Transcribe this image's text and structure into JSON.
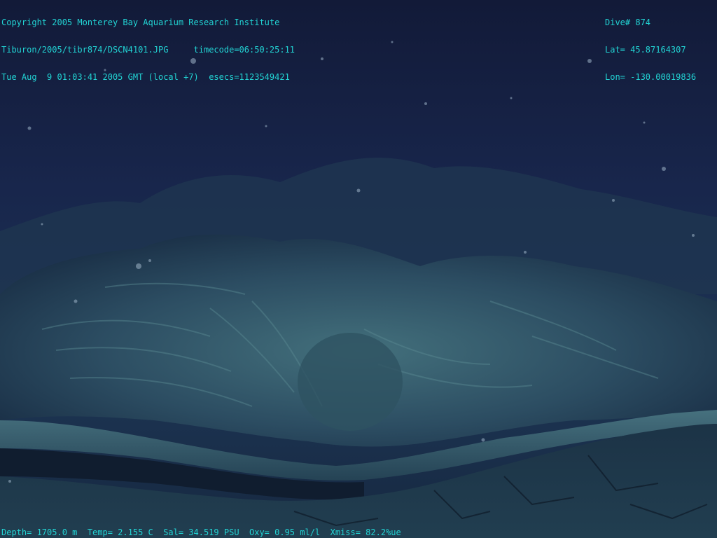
{
  "overlay": {
    "top_left": [
      "Copyright 2005 Monterey Bay Aquarium Research Institute",
      "Tiburon/2005/tibr874/DSCN4101.JPG     timecode=06:50:25:11",
      "Tue Aug  9 01:03:41 2005 GMT (local +7)  esecs=1123549421"
    ],
    "top_right": [
      "Dive# 874",
      "Lat= 45.87164307",
      "Lon= -130.00019836"
    ],
    "bottom": "Depth= 1705.0 m  Temp= 2.155 C  Sal= 34.519 PSU  Oxy= 0.95 ml/l  Xmiss= 82.2%ue"
  },
  "colors": {
    "overlay_text": "#22d4d4",
    "water_top": "#131b3a",
    "water_mid": "#1b2d52",
    "rock_light": "#3f6a78",
    "rock_dark": "#142235"
  }
}
